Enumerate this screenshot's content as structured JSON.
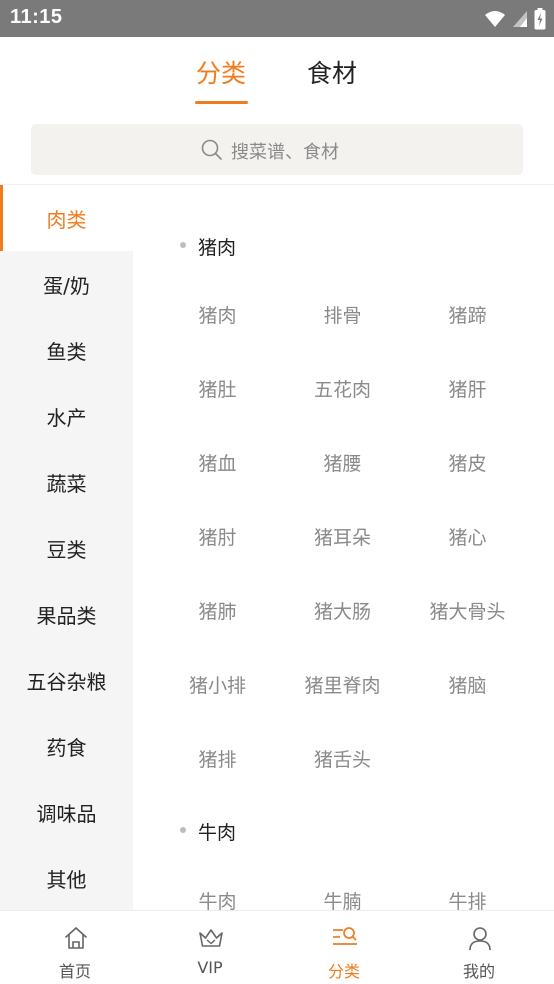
{
  "status_bar": {
    "time": "11:15"
  },
  "top_tabs": [
    {
      "label": "分类",
      "active": true
    },
    {
      "label": "食材",
      "active": false
    }
  ],
  "search": {
    "placeholder": "搜菜谱、食材"
  },
  "sidebar": {
    "items": [
      {
        "label": "肉类",
        "active": true
      },
      {
        "label": "蛋/奶"
      },
      {
        "label": "鱼类"
      },
      {
        "label": "水产"
      },
      {
        "label": "蔬菜"
      },
      {
        "label": "豆类"
      },
      {
        "label": "果品类"
      },
      {
        "label": "五谷杂粮"
      },
      {
        "label": "药食"
      },
      {
        "label": "调味品"
      },
      {
        "label": "其他"
      }
    ]
  },
  "sections": [
    {
      "title": "猪肉",
      "items": [
        "猪肉",
        "排骨",
        "猪蹄",
        "猪肚",
        "五花肉",
        "猪肝",
        "猪血",
        "猪腰",
        "猪皮",
        "猪肘",
        "猪耳朵",
        "猪心",
        "猪肺",
        "猪大肠",
        "猪大骨头",
        "猪小排",
        "猪里脊肉",
        "猪脑",
        "猪排",
        "猪舌头"
      ]
    },
    {
      "title": "牛肉",
      "items": [
        "牛肉",
        "牛腩",
        "牛排"
      ]
    }
  ],
  "bottom_nav": [
    {
      "label": "首页",
      "icon": "home-icon"
    },
    {
      "label": "VIP",
      "icon": "crown-icon"
    },
    {
      "label": "分类",
      "icon": "category-search-icon",
      "active": true
    },
    {
      "label": "我的",
      "icon": "user-icon"
    }
  ],
  "colors": {
    "accent": "#f07c1e",
    "sidebar_bg": "#f5f5f5",
    "search_bg": "#f3f2ee"
  }
}
